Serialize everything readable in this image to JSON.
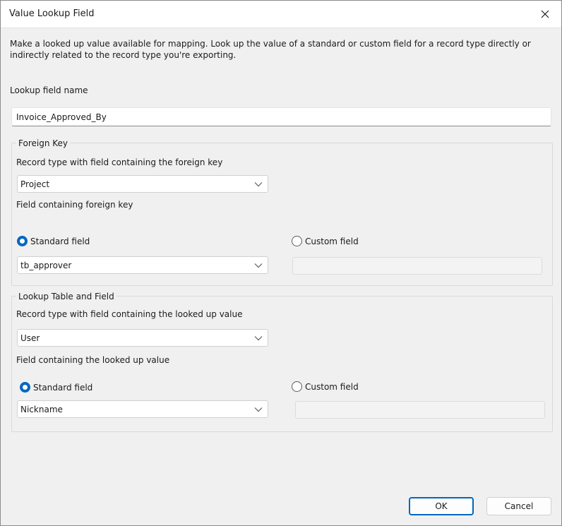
{
  "dialog": {
    "title": "Value Lookup Field",
    "description": "Make a looked up value available for mapping. Look up the value of a standard or custom field for a record type directly or indirectly related to the record type you're exporting."
  },
  "lookup_name": {
    "label": "Lookup field name",
    "value": "Invoice_Approved_By"
  },
  "foreign_key": {
    "legend": "Foreign Key",
    "record_type_label": "Record type with field containing the foreign key",
    "record_type_value": "Project",
    "field_label": "Field containing foreign key",
    "standard_label": "Standard field",
    "custom_label": "Custom field",
    "standard_value": "tb_approver",
    "selected": "standard"
  },
  "lookup_table": {
    "legend": "Lookup Table and Field",
    "record_type_label": "Record type with field containing the looked up value",
    "record_type_value": "User",
    "field_label": "Field containing the looked up value",
    "standard_label": "Standard field",
    "custom_label": "Custom field",
    "standard_value": "Nickname",
    "selected": "standard"
  },
  "buttons": {
    "ok": "OK",
    "cancel": "Cancel"
  },
  "icons": {
    "close": "close-icon",
    "dropdown": "chevron-down-icon"
  },
  "colors": {
    "accent": "#0067c0",
    "window_bg": "#f0f0f0"
  }
}
